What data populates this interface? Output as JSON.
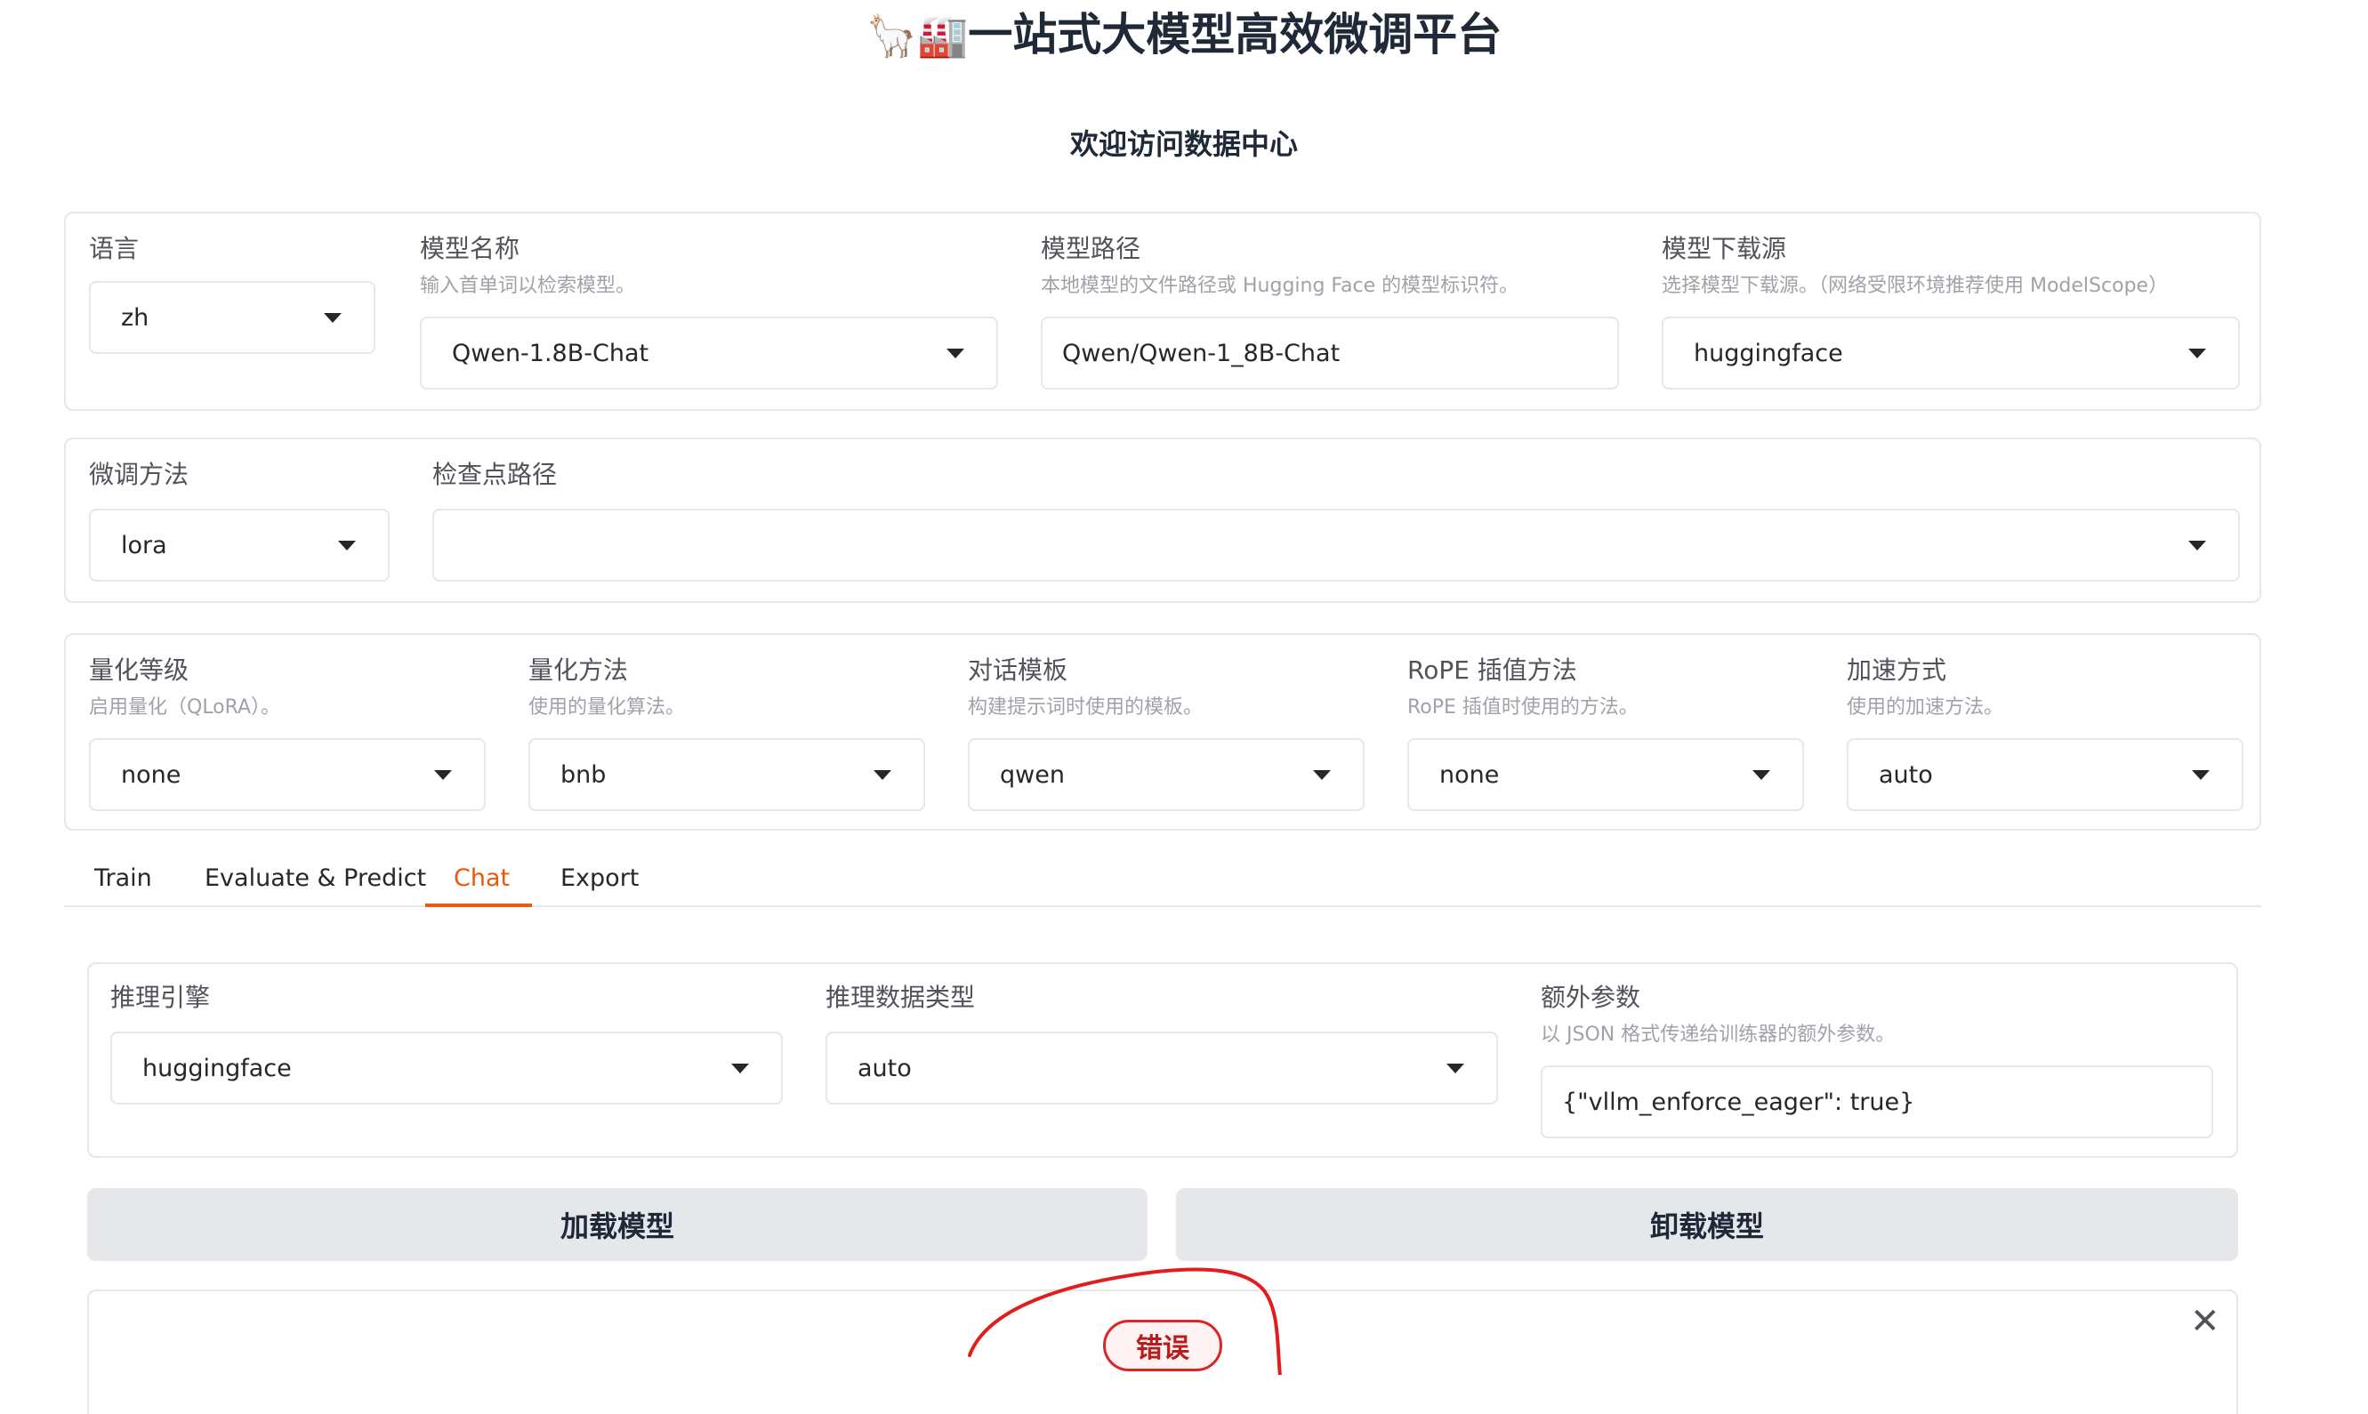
{
  "header": {
    "emoji": "🦙🏭",
    "title": "一站式大模型高效微调平台",
    "subtitle": "欢迎访问数据中心"
  },
  "row1": {
    "language": {
      "label": "语言",
      "value": "zh"
    },
    "model_name": {
      "label": "模型名称",
      "info": "输入首单词以检索模型。",
      "value": "Qwen-1.8B-Chat"
    },
    "model_path": {
      "label": "模型路径",
      "info": "本地模型的文件路径或 Hugging Face 的模型标识符。",
      "value": "Qwen/Qwen-1_8B-Chat"
    },
    "download_source": {
      "label": "模型下载源",
      "info": "选择模型下载源。（网络受限环境推荐使用 ModelScope）",
      "value": "huggingface"
    }
  },
  "row2": {
    "finetune_method": {
      "label": "微调方法",
      "value": "lora"
    },
    "checkpoint_path": {
      "label": "检查点路径",
      "value": ""
    }
  },
  "row3": {
    "quant_bit": {
      "label": "量化等级",
      "info": "启用量化（QLoRA）。",
      "value": "none"
    },
    "quant_method": {
      "label": "量化方法",
      "info": "使用的量化算法。",
      "value": "bnb"
    },
    "template": {
      "label": "对话模板",
      "info": "构建提示词时使用的模板。",
      "value": "qwen"
    },
    "rope_scaling": {
      "label": "RoPE 插值方法",
      "info": "RoPE 插值时使用的方法。",
      "value": "none"
    },
    "booster": {
      "label": "加速方式",
      "info": "使用的加速方法。",
      "value": "auto"
    }
  },
  "tabs": [
    "Train",
    "Evaluate & Predict",
    "Chat",
    "Export"
  ],
  "active_tab": "Chat",
  "chat": {
    "infer_backend": {
      "label": "推理引擎",
      "value": "huggingface"
    },
    "infer_dtype": {
      "label": "推理数据类型",
      "value": "auto"
    },
    "extra_args": {
      "label": "额外参数",
      "info": "以 JSON 格式传递给训练器的额外参数。",
      "value": "{\"vllm_enforce_eager\": true}"
    },
    "load_button": "加载模型",
    "unload_button": "卸载模型",
    "error_label": "错误"
  },
  "colors": {
    "accent": "#ea580c",
    "error": "#dc2626",
    "annotation": "#e11d1d"
  }
}
